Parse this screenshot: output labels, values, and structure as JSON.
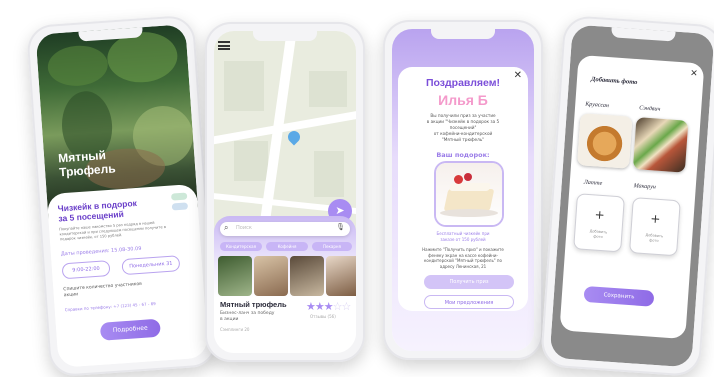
{
  "phone1": {
    "photo_title": "Мятный\nТрюфель",
    "promo_title": "Чизкейк в подорок\nза 5 посещений",
    "promo_desc": "Покупайте наше лакомство 5 раз подряд в нашей кондитерской и при следующем посещении получите в подарок чизкейк, от 150 рублей.",
    "dates_label": "Даты проведения: 15.08-30.09",
    "time_chip": "9:00-22:00",
    "day_chip": "Понедельник 31",
    "count_label": "Спишите количество участников\nакции",
    "phone_label": "Справки по телефону: +7 (123) 45 - 67 - 89",
    "more_button": "Подробнее"
  },
  "phone2": {
    "search_placeholder": "Поиск",
    "chips": [
      "Кондитерская",
      "Кофейня",
      "Пекарня"
    ],
    "place_name": "Мятный трюфель",
    "place_desc": "Бизнес-ланч за победу\nв акции",
    "place_meta": "Сэмплинги 20",
    "rating_label": "Отзывы (56)",
    "rating": 3
  },
  "phone3": {
    "title": "Поздравляем!",
    "name": "Илья Б",
    "message": "Вы получили приз за участие\nв акции \"Чизкейк в подорок за 5\nпосещений\"\nот кофейни-кондитерской\n\"Мятный трюфель\"",
    "gift_label": "Ваш подорок:",
    "gift_caption": "Бесплатный чизкейк при\nзаказе от 150 рублей",
    "instructions": "Нажмите \"Получить приз\" и покажите\nфенеку экран на кассе кофейни-\nкондитерской \"Мятный трюфель\" по\nадресу Ленинская, 21",
    "get_prize_button": "Получить приз",
    "my_prizes_button": "Мои предложения"
  },
  "phone4": {
    "title": "Добавить фото",
    "items": [
      "Круассан",
      "Сэндвич",
      "Латте",
      "Макарун"
    ],
    "add_label": "Добавить\nфото",
    "save_button": "Сохранить"
  },
  "colors": {
    "accent": "#8f6be6",
    "accent_light": "#c9b8f3",
    "title_purple": "#7b4ed9",
    "pink": "#f49acb",
    "text_dark": "#2b2b3a"
  }
}
